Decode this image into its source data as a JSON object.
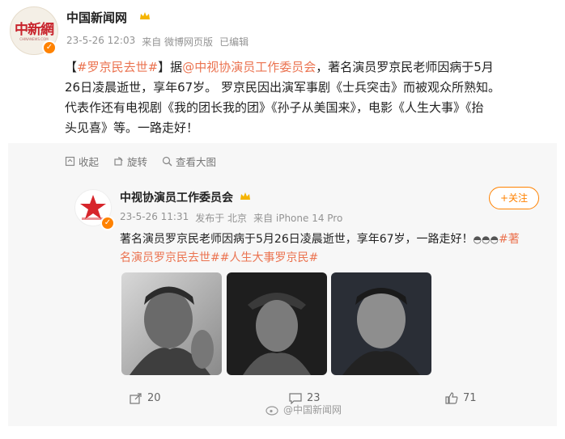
{
  "post": {
    "author": "中国新闻网",
    "avatar_logo": "中新網",
    "avatar_sub": "CHINANEWS.COM",
    "time": "23-5-26 12:03",
    "source": "来自 微博网页版",
    "edited": "已编辑",
    "text": {
      "hashtag": "#罗京民去世#",
      "bracket_open": "【",
      "bracket_close": "】",
      "ju": "据",
      "mention": "@中视协演员工作委员会",
      "line1_tail": "，著名演员罗京民老师因病于5月",
      "line2": "26日凌晨逝世，享年67岁。 罗京民因出演军事剧《士兵突击》而被观众所熟知。",
      "line3": "代表作还有电视剧《我的团长我的团》《孙子从美国来》，电影《人生大事》《抬",
      "line4": "头见喜》等。一路走好！"
    }
  },
  "toolbar": {
    "collect": "收起",
    "rotate": "旋转",
    "view_large": "查看大图"
  },
  "repost": {
    "author": "中视协演员工作委员会",
    "follow_label": "+关注",
    "time": "23-5-26 11:31",
    "location": "发布于 北京",
    "source": "来自 iPhone 14 Pro",
    "text_line1": "著名演员罗京民老师因病于5月26日凌晨逝世，享年67岁，一路走好！",
    "emoji_tail": "#著",
    "text_line2_tags": "名演员罗京民去世##人生大事罗京民#",
    "photos": [
      "photo-1",
      "photo-2",
      "photo-3"
    ],
    "share_count": "20",
    "comment_count": "23",
    "like_count": "71",
    "watermark": "@中国新闻网"
  },
  "colors": {
    "accent": "#ff8200",
    "tag": "#eb7350",
    "meta": "#939393",
    "repost_bg": "#f7f7f7"
  }
}
